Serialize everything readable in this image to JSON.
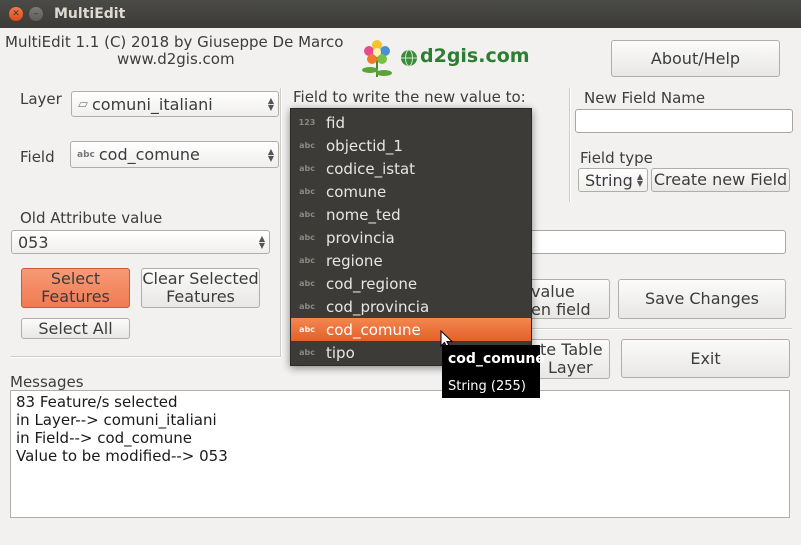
{
  "window": {
    "title": "MultiEdit"
  },
  "header": {
    "credit": "MultiEdit 1.1  (C) 2018 by Giuseppe De Marco",
    "website": "www.d2gis.com",
    "logo_text": "d2gis.com",
    "about_button": "About/Help"
  },
  "left": {
    "layer_label": "Layer",
    "layer_value": "comuni_italiani",
    "field_label": "Field",
    "field_value": "cod_comune",
    "field_type_badge": "abc",
    "old_attr_label": "Old Attribute value",
    "old_attr_value": "053",
    "select_features": "Select Features",
    "clear_selected": "Clear Selected Features",
    "select_all": "Select All"
  },
  "middle": {
    "field_to_write_label": "Field to write the new value to:",
    "dropdown_items": [
      {
        "type": "123",
        "name": "fid"
      },
      {
        "type": "abc",
        "name": "objectid_1"
      },
      {
        "type": "abc",
        "name": "codice_istat"
      },
      {
        "type": "abc",
        "name": "comune"
      },
      {
        "type": "abc",
        "name": "nome_ted"
      },
      {
        "type": "abc",
        "name": "provincia"
      },
      {
        "type": "abc",
        "name": "regione"
      },
      {
        "type": "abc",
        "name": "cod_regione"
      },
      {
        "type": "abc",
        "name": "cod_provincia"
      },
      {
        "type": "abc",
        "name": "cod_comune"
      },
      {
        "type": "abc",
        "name": "tipo"
      }
    ],
    "selected_index": 9,
    "tooltip_title": "cod_comune",
    "tooltip_sub": "String (255)",
    "partial_value_btn_l1": "value",
    "partial_value_btn_l2": "en field",
    "partial_table_btn_l1": "te Table",
    "partial_table_btn_l2": "Layer"
  },
  "right": {
    "new_field_label": "New Field Name",
    "new_field_value": "",
    "field_type_label": "Field type",
    "field_type_value": "String",
    "create_field_button": "Create new Field",
    "new_value_input": "",
    "save_button": "Save Changes",
    "exit_button": "Exit"
  },
  "messages": {
    "label": "Messages",
    "lines": [
      "83 Feature/s selected",
      "in Layer--> comuni_italiani",
      "in Field--> cod_comune",
      "Value to be modified--> 053"
    ]
  }
}
